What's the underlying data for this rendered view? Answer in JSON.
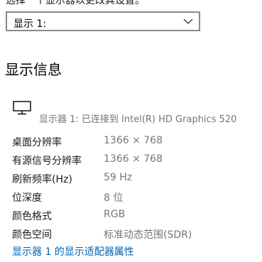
{
  "intro_text": "选择一个显示器以更改其设置。",
  "display_select": {
    "value": "显示 1:"
  },
  "section_title": "显示信息",
  "monitor": {
    "icon": "monitor-icon",
    "description": "显示器 1: 已连接到 Intel(R) HD Graphics 520"
  },
  "info_rows": [
    {
      "label": "桌面分辨率",
      "value": "1366 × 768"
    },
    {
      "label": "有源信号分辨率",
      "value": "1366 × 768"
    },
    {
      "label": "刷新频率(Hz)",
      "value": "59 Hz"
    },
    {
      "label": "位深度",
      "value": "8 位"
    },
    {
      "label": "颜色格式",
      "value": "RGB"
    },
    {
      "label": "颜色空间",
      "value": "标准动态范围(SDR)"
    }
  ],
  "adapter_link": "显示器 1 的显示适配器属性",
  "colors": {
    "link": "#0063b1",
    "secondary_text": "#767676",
    "dropdown_border": "#8a8a8a"
  }
}
